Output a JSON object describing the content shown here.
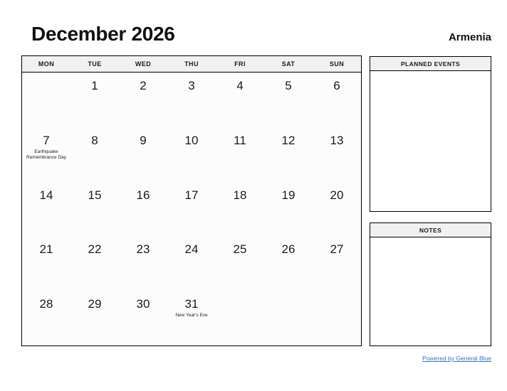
{
  "header": {
    "month_title": "December 2026",
    "country": "Armenia"
  },
  "calendar": {
    "weekday_headers": [
      "MON",
      "TUE",
      "WED",
      "THU",
      "FRI",
      "SAT",
      "SUN"
    ],
    "weeks": [
      [
        {
          "day": "",
          "event": ""
        },
        {
          "day": "1",
          "event": ""
        },
        {
          "day": "2",
          "event": ""
        },
        {
          "day": "3",
          "event": ""
        },
        {
          "day": "4",
          "event": ""
        },
        {
          "day": "5",
          "event": ""
        },
        {
          "day": "6",
          "event": ""
        }
      ],
      [
        {
          "day": "7",
          "event": "Earthquake Remembrance Day"
        },
        {
          "day": "8",
          "event": ""
        },
        {
          "day": "9",
          "event": ""
        },
        {
          "day": "10",
          "event": ""
        },
        {
          "day": "11",
          "event": ""
        },
        {
          "day": "12",
          "event": ""
        },
        {
          "day": "13",
          "event": ""
        }
      ],
      [
        {
          "day": "14",
          "event": ""
        },
        {
          "day": "15",
          "event": ""
        },
        {
          "day": "16",
          "event": ""
        },
        {
          "day": "17",
          "event": ""
        },
        {
          "day": "18",
          "event": ""
        },
        {
          "day": "19",
          "event": ""
        },
        {
          "day": "20",
          "event": ""
        }
      ],
      [
        {
          "day": "21",
          "event": ""
        },
        {
          "day": "22",
          "event": ""
        },
        {
          "day": "23",
          "event": ""
        },
        {
          "day": "24",
          "event": ""
        },
        {
          "day": "25",
          "event": ""
        },
        {
          "day": "26",
          "event": ""
        },
        {
          "day": "27",
          "event": ""
        }
      ],
      [
        {
          "day": "28",
          "event": ""
        },
        {
          "day": "29",
          "event": ""
        },
        {
          "day": "30",
          "event": ""
        },
        {
          "day": "31",
          "event": "New Year's Eve"
        },
        {
          "day": "",
          "event": ""
        },
        {
          "day": "",
          "event": ""
        },
        {
          "day": "",
          "event": ""
        }
      ]
    ]
  },
  "panels": {
    "planned_events": {
      "title": "PLANNED EVENTS",
      "content": ""
    },
    "notes": {
      "title": "NOTES",
      "content": ""
    }
  },
  "footer": {
    "credit_text": "Powered by General Blue"
  },
  "colors": {
    "link": "#3a6fd8",
    "header_band": "#f1f1f1",
    "border": "#000000",
    "text": "#1a1a1a"
  }
}
